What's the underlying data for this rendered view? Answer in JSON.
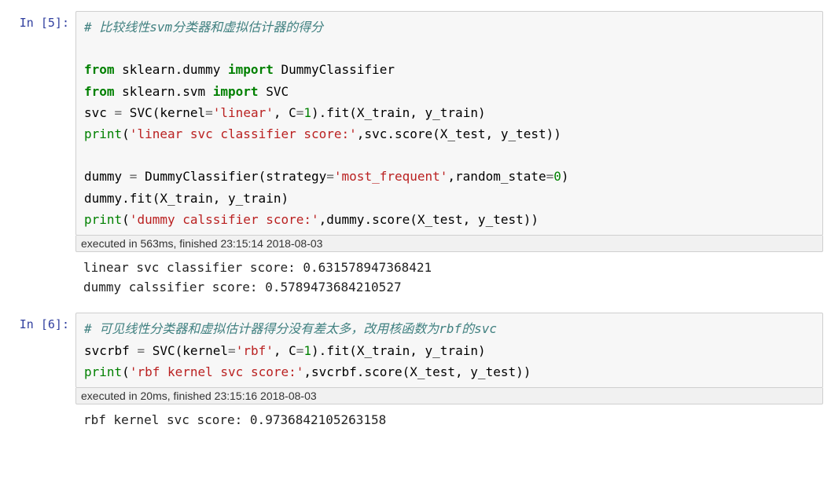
{
  "cells": [
    {
      "prompt": "In  [5]:",
      "code": {
        "comment1": "# 比较线性svm分类器和虚拟估计器的得分",
        "blank1": "",
        "l3a": "from",
        "l3b": " sklearn.dummy ",
        "l3c": "import",
        "l3d": " DummyClassifier",
        "l4a": "from",
        "l4b": " sklearn.svm ",
        "l4c": "import",
        "l4d": " SVC",
        "l5a": "svc ",
        "l5b": "=",
        "l5c": " SVC(kernel",
        "l5d": "=",
        "l5e": "'linear'",
        "l5f": ", C",
        "l5g": "=",
        "l5h": "1",
        "l5i": ").fit(X_train, y_train)",
        "l6a": "print",
        "l6b": "(",
        "l6c": "'linear svc classifier score:'",
        "l6d": ",svc.score(X_test, y_test))",
        "blank2": "",
        "l8a": "dummy ",
        "l8b": "=",
        "l8c": " DummyClassifier(strategy",
        "l8d": "=",
        "l8e": "'most_frequent'",
        "l8f": ",random_state",
        "l8g": "=",
        "l8h": "0",
        "l8i": ")",
        "l9": "dummy.fit(X_train, y_train)",
        "l10a": "print",
        "l10b": "(",
        "l10c": "'dummy calssifier score:'",
        "l10d": ",dummy.score(X_test, y_test))"
      },
      "timing": "executed in 563ms, finished 23:15:14 2018-08-03",
      "output": "linear svc classifier score: 0.631578947368421\ndummy calssifier score: 0.5789473684210527"
    },
    {
      "prompt": "In  [6]:",
      "code": {
        "comment1": "# 可见线性分类器和虚拟估计器得分没有差太多，改用核函数为rbf的svc",
        "l2a": "svcrbf ",
        "l2b": "=",
        "l2c": " SVC(kernel",
        "l2d": "=",
        "l2e": "'rbf'",
        "l2f": ", C",
        "l2g": "=",
        "l2h": "1",
        "l2i": ").fit(X_train, y_train)",
        "l3a": "print",
        "l3b": "(",
        "l3c": "'rbf kernel svc score:'",
        "l3d": ",svcrbf.score(X_test, y_test))"
      },
      "timing": "executed in 20ms, finished 23:15:16 2018-08-03",
      "output": "rbf kernel svc score: 0.9736842105263158"
    }
  ]
}
